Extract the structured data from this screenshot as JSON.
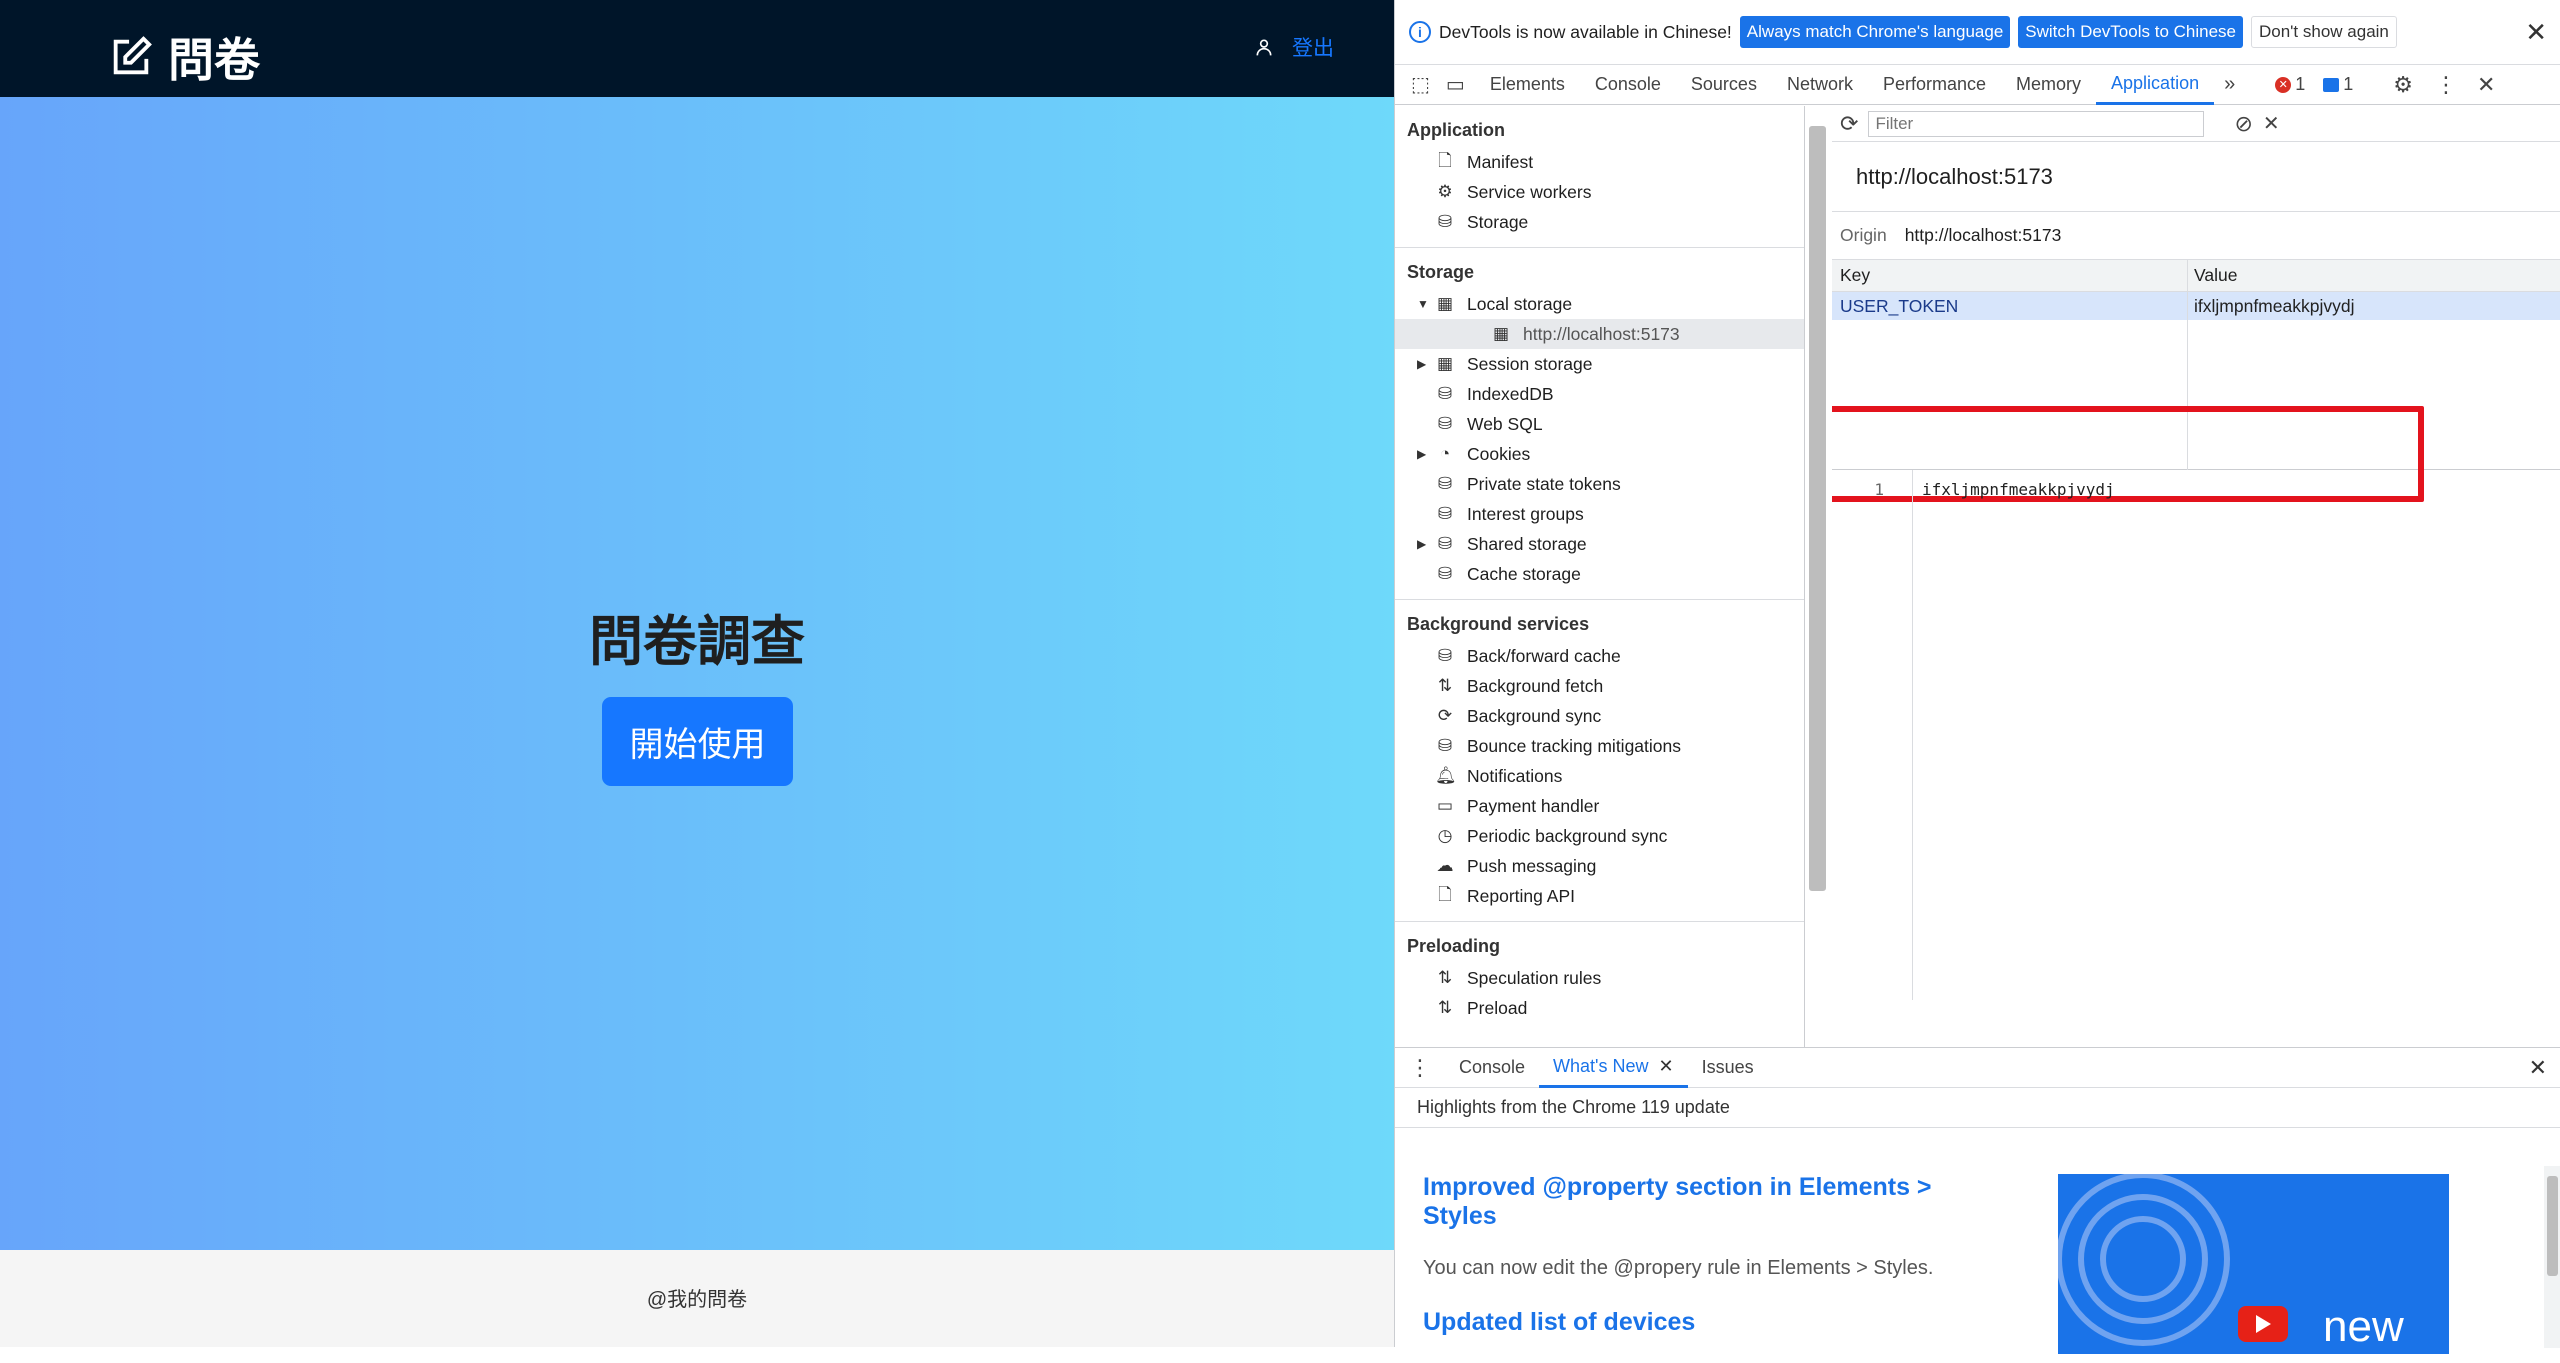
{
  "app": {
    "logo_text": "問卷",
    "logout_label": "登出",
    "hero_title": "問卷調查",
    "start_button": "開始使用",
    "footer_text": "@我的問卷"
  },
  "devtools": {
    "info_bar": {
      "message": "DevTools is now available in Chinese!",
      "btn_match": "Always match Chrome's language",
      "btn_switch": "Switch DevTools to Chinese",
      "btn_dismiss": "Don't show again"
    },
    "tabs": [
      "Elements",
      "Console",
      "Sources",
      "Network",
      "Performance",
      "Memory",
      "Application"
    ],
    "error_count": "1",
    "message_count": "1",
    "sidebar": {
      "application_title": "Application",
      "application_items": [
        "Manifest",
        "Service workers",
        "Storage"
      ],
      "storage_title": "Storage",
      "storage_items": [
        "Local storage",
        "http://localhost:5173",
        "Session storage",
        "IndexedDB",
        "Web SQL",
        "Cookies",
        "Private state tokens",
        "Interest groups",
        "Shared storage",
        "Cache storage"
      ],
      "background_title": "Background services",
      "background_items": [
        "Back/forward cache",
        "Background fetch",
        "Background sync",
        "Bounce tracking mitigations",
        "Notifications",
        "Payment handler",
        "Periodic background sync",
        "Push messaging",
        "Reporting API"
      ],
      "preloading_title": "Preloading",
      "preloading_items": [
        "Speculation rules",
        "Preload"
      ]
    },
    "main": {
      "filter_placeholder": "Filter",
      "origin_title": "http://localhost:5173",
      "origin_label": "Origin",
      "origin_value": "http://localhost:5173",
      "col_key": "Key",
      "col_value": "Value",
      "row_key": "USER_TOKEN",
      "row_value": "ifxljmpnfmeakkpjvydj",
      "line_number": "1",
      "code_line": "ifxljmpnfmeakkpjvydj"
    },
    "drawer": {
      "tabs": [
        "Console",
        "What's New",
        "Issues"
      ],
      "highlights": "Highlights from the Chrome 119 update",
      "h1": "Improved @property section in Elements > Styles",
      "p1": "You can now edit the @propery rule in Elements > Styles.",
      "h2": "Updated list of devices",
      "banner_text": "new"
    }
  }
}
